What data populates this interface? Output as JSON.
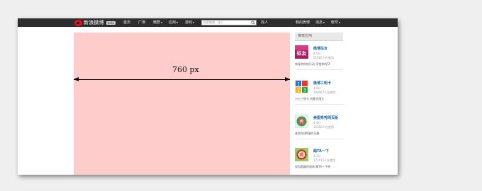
{
  "header": {
    "logo_text": "新浪微博",
    "beta_label": "beta",
    "nav": [
      {
        "label": "首页",
        "dropdown": false
      },
      {
        "label": "广场",
        "dropdown": false
      },
      {
        "label": "微群",
        "dropdown": true
      },
      {
        "label": "应用",
        "dropdown": true
      },
      {
        "label": "游戏",
        "dropdown": true
      }
    ],
    "search_placeholder": "搜索微博、找人",
    "find_people": "找人",
    "my_weibo": "我的微博",
    "messages": "消息",
    "account": "帐号",
    "colors": {
      "bar": "#2e2e2e",
      "logo": "#e8101b"
    }
  },
  "main": {
    "width_label": "760 px",
    "background": "#ffcccc"
  },
  "sidebar": {
    "title": "推荐应用",
    "apps": [
      {
        "icon": "zhengyou-app-icon",
        "name": "微博征友",
        "rating": "4.5分",
        "users": "51485人在使用",
        "desc": "单身的你快行动 寻找你的TA"
      },
      {
        "icon": "sandwich-card-app-icon",
        "name": "微博三明卡",
        "rating": "4.0分",
        "users": "309067人在使用",
        "desc": "小小三明卡 创意无限大"
      },
      {
        "icon": "meitu-app-icon",
        "name": "美图秀秀网页版",
        "rating": "4.4分",
        "users": "35300人在使用",
        "desc": "体验在线P图的乐趣"
      },
      {
        "icon": "tixiaota-app-icon",
        "name": "踢TA一下",
        "rating": "4.1分",
        "users": "172015人在使用",
        "desc": "说用超幽的道具 踢TA一下吧"
      }
    ]
  }
}
